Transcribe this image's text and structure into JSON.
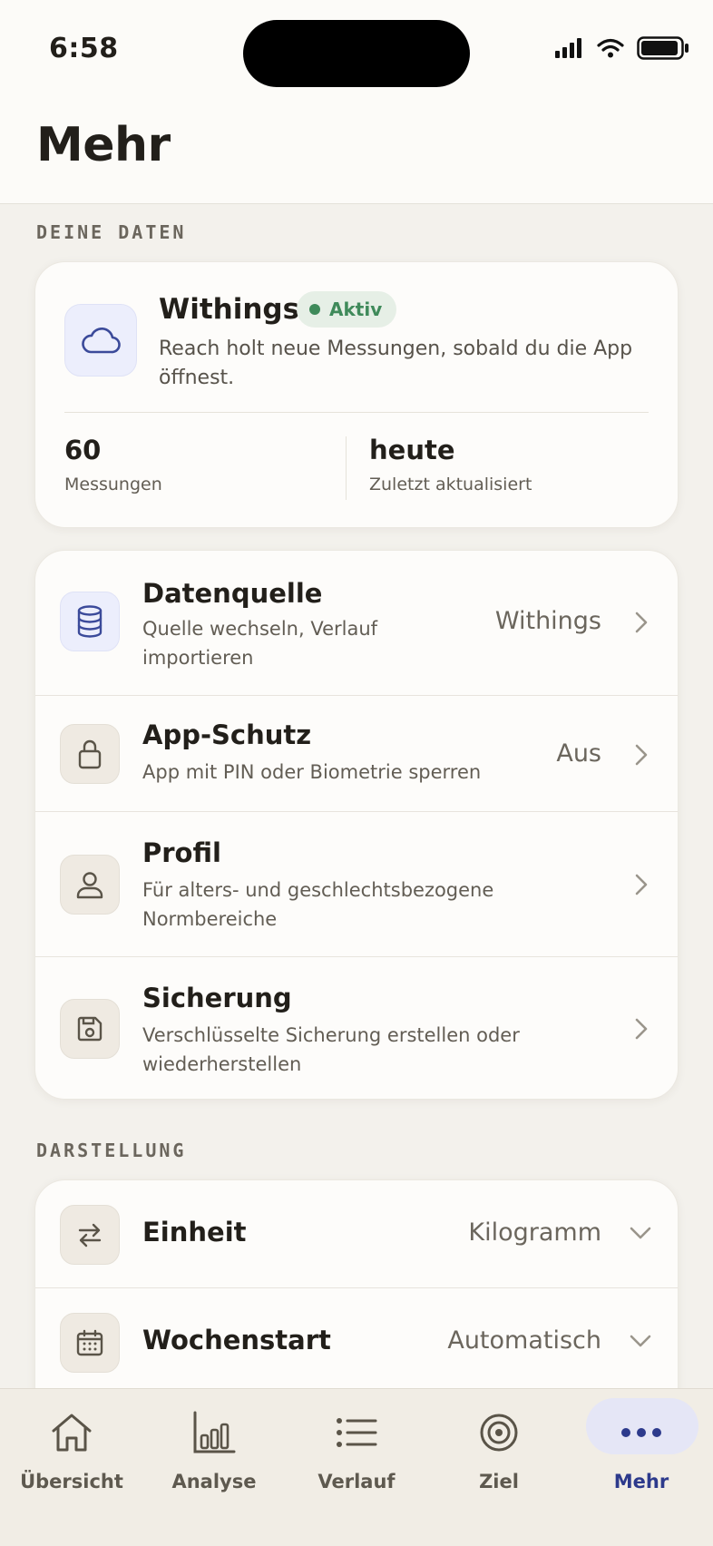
{
  "status_bar": {
    "time": "6:58"
  },
  "header": {
    "title": "Mehr"
  },
  "sections": {
    "data_label": "DEINE DATEN",
    "display_label": "DARSTELLUNG"
  },
  "withings": {
    "name": "Withings",
    "badge": "Aktiv",
    "description": "Reach holt neue Messungen, sobald du die App öffnest.",
    "measurements_value": "60",
    "measurements_label": "Messungen",
    "updated_value": "heute",
    "updated_label": "Zuletzt aktualisiert"
  },
  "settings": {
    "datasource": {
      "title": "Datenquelle",
      "subtitle": "Quelle wechseln, Verlauf importieren",
      "value": "Withings",
      "icon": "database-icon"
    },
    "app_lock": {
      "title": "App-Schutz",
      "subtitle": "App mit PIN oder Biometrie sperren",
      "value": "Aus",
      "icon": "lock-icon"
    },
    "profile": {
      "title": "Profil",
      "subtitle": "Für alters- und geschlechtsbezogene Normbereiche",
      "icon": "user-icon"
    },
    "backup": {
      "title": "Sicherung",
      "subtitle": "Verschlüsselte Sicherung erstellen oder wiederherstellen",
      "icon": "save-icon"
    }
  },
  "display": {
    "unit": {
      "title": "Einheit",
      "value": "Kilogramm",
      "icon": "swap-arrows-icon"
    },
    "week_start": {
      "title": "Wochenstart",
      "value": "Automatisch",
      "icon": "calendar-icon"
    }
  },
  "tabbar": {
    "tabs": [
      {
        "label": "Übersicht",
        "icon": "home-icon"
      },
      {
        "label": "Analyse",
        "icon": "bar-chart-icon"
      },
      {
        "label": "Verlauf",
        "icon": "list-icon"
      },
      {
        "label": "Ziel",
        "icon": "target-icon"
      },
      {
        "label": "Mehr",
        "icon": "more-dots-icon",
        "active": true
      }
    ]
  },
  "colors": {
    "accent": "#2d3a8c",
    "active_green": "#3f8a5a",
    "background": "#f3f1ec"
  }
}
